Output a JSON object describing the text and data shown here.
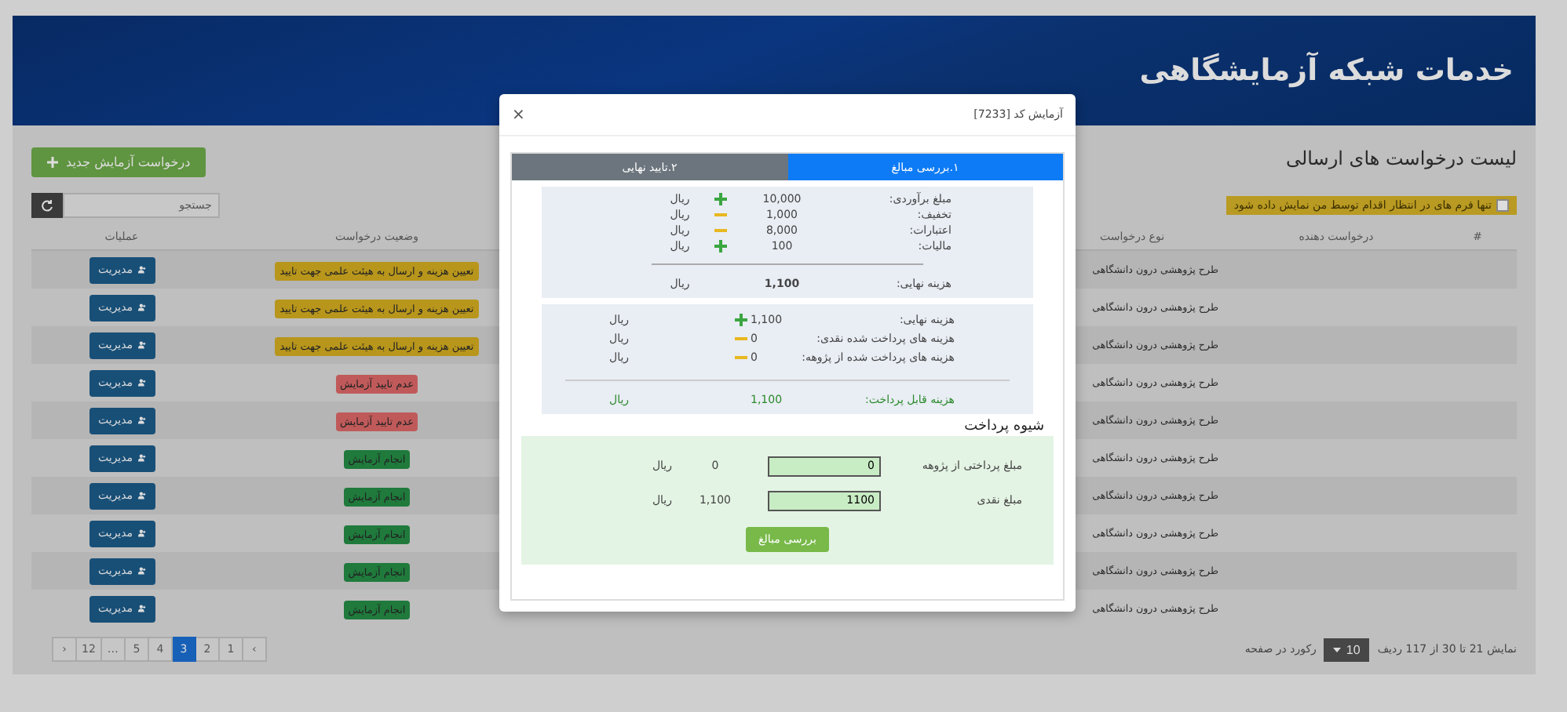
{
  "header": {
    "title": "خدمات شبکه آزمایشگاهی"
  },
  "list": {
    "title": "لیست درخواست های ارسالی",
    "new_button": "درخواست آزمایش جدید",
    "filter": {
      "label": "تنها فرم های در انتظار اقدام توسط من نمایش داده شود",
      "checked": false
    },
    "search": {
      "placeholder": "جستجو"
    },
    "columns": [
      "#",
      "درخواست دهنده",
      "نوع درخواست",
      "وضعیت درخواست",
      "عملیات"
    ],
    "rows": [
      {
        "type": "طرح پژوهشی درون دانشگاهی",
        "status": "تعیین هزینه و ارسال به هیئت علمی جهت تایید",
        "color": "#b8961c",
        "action": "مدیریت"
      },
      {
        "type": "طرح پژوهشی درون دانشگاهی",
        "status": "تعیین هزینه و ارسال به هیئت علمی جهت تایید",
        "color": "#b8961c",
        "action": "مدیریت"
      },
      {
        "type": "طرح پژوهشی درون دانشگاهی",
        "status": "تعیین هزینه و ارسال به هیئت علمی جهت تایید",
        "color": "#b8961c",
        "action": "مدیریت"
      },
      {
        "type": "طرح پژوهشی درون دانشگاهی",
        "status": "عدم تایید آزمایش",
        "color": "#c05a5a",
        "action": "مدیریت"
      },
      {
        "type": "طرح پژوهشی درون دانشگاهی",
        "status": "عدم تایید آزمایش",
        "color": "#c05a5a",
        "action": "مدیریت"
      },
      {
        "type": "طرح پژوهشی درون دانشگاهی",
        "status": "انجام آزمایش",
        "color": "#1f7a3c",
        "action": "مدیریت"
      },
      {
        "type": "طرح پژوهشی درون دانشگاهی",
        "status": "انجام آزمایش",
        "color": "#1f7a3c",
        "action": "مدیریت"
      },
      {
        "type": "طرح پژوهشی درون دانشگاهی",
        "status": "انجام آزمایش",
        "color": "#1f7a3c",
        "action": "مدیریت"
      },
      {
        "type": "طرح پژوهشی درون دانشگاهی",
        "status": "انجام آزمایش",
        "color": "#1f7a3c",
        "action": "مدیریت"
      },
      {
        "type": "طرح پژوهشی درون دانشگاهی",
        "status": "انجام آزمایش",
        "color": "#1f7a3c",
        "action": "مدیریت"
      }
    ],
    "pagination": [
      {
        "label": "›",
        "selected": false
      },
      {
        "label": "1",
        "selected": false
      },
      {
        "label": "2",
        "selected": false
      },
      {
        "label": "3",
        "selected": true
      },
      {
        "label": "4",
        "selected": false
      },
      {
        "label": "5",
        "selected": false
      },
      {
        "label": "…",
        "selected": false
      },
      {
        "label": "12",
        "selected": false
      },
      {
        "label": "‹",
        "selected": false
      }
    ],
    "summary": "نمایش 21 تا 30 از 117 ردیف",
    "page_size": "10",
    "page_size_label": "رکورد در صفحه"
  },
  "modal": {
    "title": "آزمایش کد [7233]",
    "close": "×",
    "tabs": [
      {
        "label": "۱.بررسی مبالغ",
        "selected": true
      },
      {
        "label": "۲.تایید نهایی",
        "selected": false
      }
    ],
    "costs": [
      {
        "label": "مبلغ برآوردی:",
        "amount": "10,000",
        "kind": "plus",
        "unit": "ریال"
      },
      {
        "label": "تخفیف:",
        "amount": "1,000",
        "kind": "minus",
        "unit": "ریال"
      },
      {
        "label": "اعتبارات:",
        "amount": "8,000",
        "kind": "minus",
        "unit": "ریال"
      },
      {
        "label": "مالیات:",
        "amount": "100",
        "kind": "plus",
        "unit": "ریال"
      }
    ],
    "final": {
      "label": "هزینه نهایی:",
      "amount": "1,100",
      "unit": "ریال"
    },
    "payments": [
      {
        "label": "هزینه نهایی:",
        "amount": "1,100",
        "kind": "plus",
        "unit": "ریال"
      },
      {
        "label": "هزینه های پرداخت شده نقدی:",
        "amount": "0",
        "kind": "minus",
        "unit": "ریال"
      },
      {
        "label": "هزینه های پرداخت شده از پژوهه:",
        "amount": "0",
        "kind": "minus",
        "unit": "ریال"
      }
    ],
    "payable": {
      "label": "هزینه قابل پرداخت:",
      "amount": "1,100",
      "unit": "ریال"
    },
    "method_title": "شیوه پرداخت",
    "method_rows": [
      {
        "label": "مبلغ پرداختی از پژوهه",
        "value": "0",
        "amount": "0",
        "unit": "ریال"
      },
      {
        "label": "مبلغ نقدی",
        "value": "1100",
        "amount": "1,100",
        "unit": "ریال"
      }
    ],
    "check_button": "بررسی مبالغ"
  }
}
